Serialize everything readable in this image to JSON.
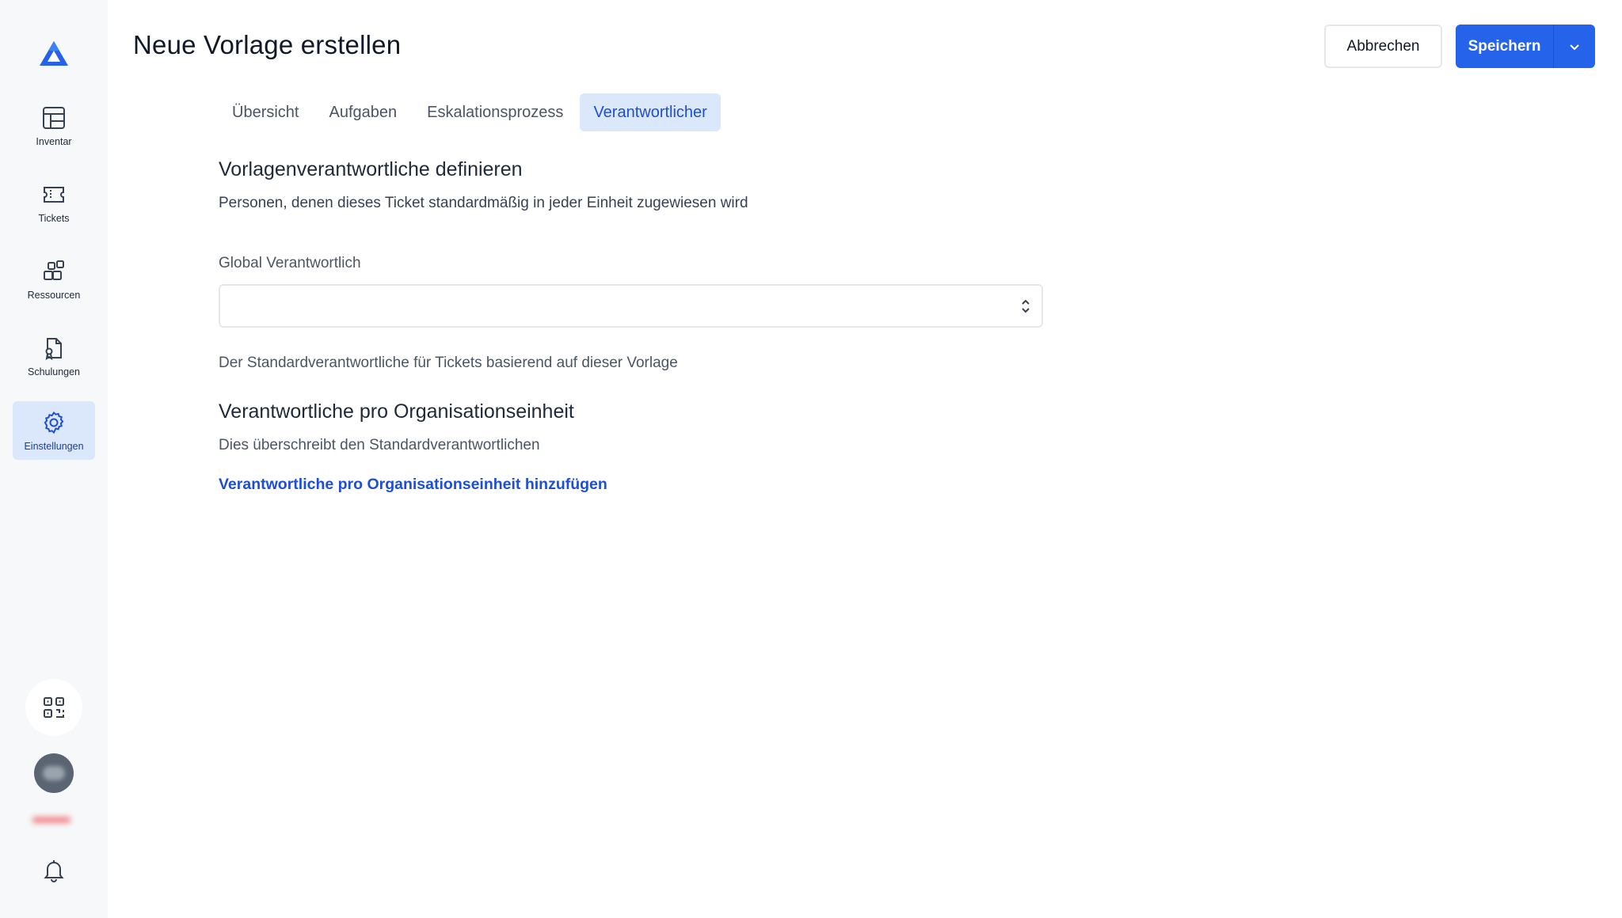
{
  "header": {
    "title": "Neue Vorlage erstellen",
    "cancel_label": "Abbrechen",
    "save_label": "Speichern"
  },
  "sidebar": {
    "items": [
      {
        "label": "Inventar",
        "icon": "table-icon"
      },
      {
        "label": "Tickets",
        "icon": "ticket-icon"
      },
      {
        "label": "Ressourcen",
        "icon": "resources-icon"
      },
      {
        "label": "Schulungen",
        "icon": "training-icon"
      },
      {
        "label": "Einstellungen",
        "icon": "gear-icon",
        "active": true
      }
    ],
    "bottom_icons": [
      "qr-code-icon",
      "avatar",
      "bell-icon"
    ]
  },
  "tabs": [
    {
      "label": "Übersicht"
    },
    {
      "label": "Aufgaben"
    },
    {
      "label": "Eskalationsprozess"
    },
    {
      "label": "Verantwortlicher",
      "active": true
    }
  ],
  "section_default": {
    "title": "Vorlagenverantwortliche definieren",
    "description": "Personen, denen dieses Ticket standardmäßig in jeder Einheit zugewiesen wird",
    "field_label": "Global Verantwortlich",
    "field_value": "",
    "help_text": "Der Standardverantwortliche für Tickets basierend auf dieser Vorlage"
  },
  "section_org": {
    "title": "Verantwortliche pro Organisationseinheit",
    "description": "Dies überschreibt den Standardverantwortlichen",
    "add_link": "Verantwortliche pro Organisationseinheit hinzufügen"
  },
  "colors": {
    "primary": "#2563eb",
    "active_bg": "#dbe7fb",
    "sidebar_bg": "#f7f8fa",
    "link": "#1d4ed8"
  }
}
